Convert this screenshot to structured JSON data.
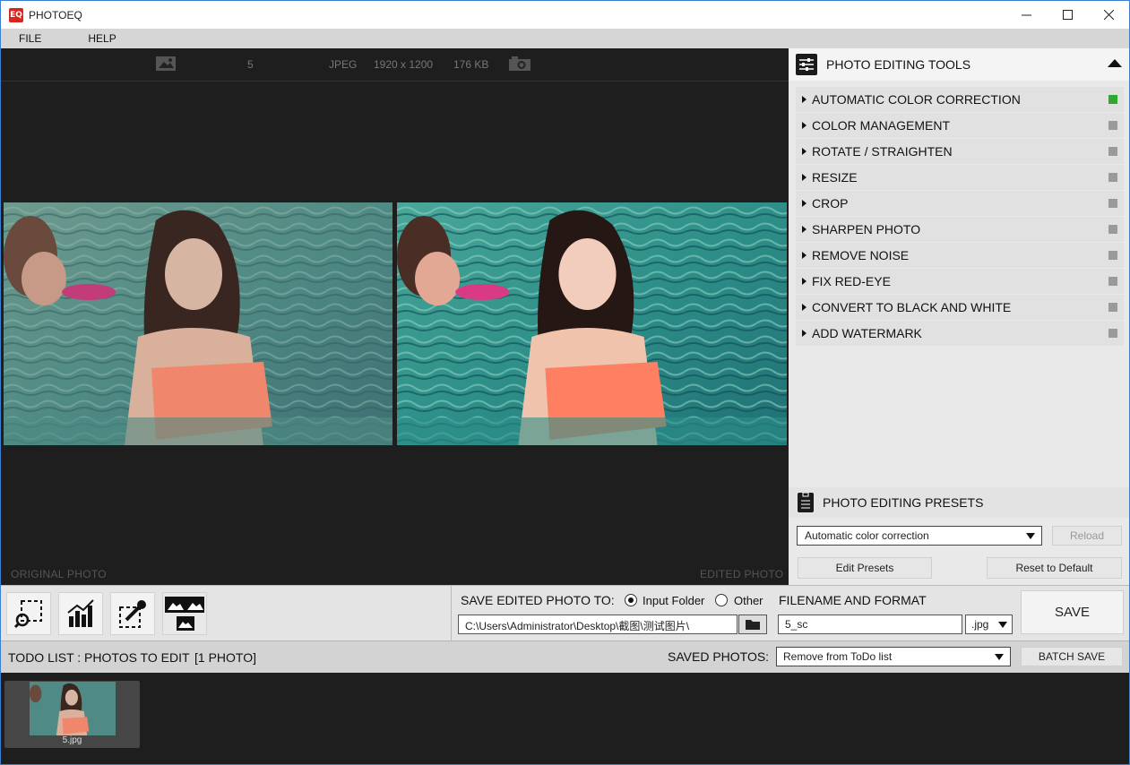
{
  "window": {
    "logo_text": "EQ",
    "title": "PHOTOEQ",
    "minimize_icon": "minimize-icon",
    "maximize_icon": "maximize-icon",
    "close_icon": "close-icon"
  },
  "menu": {
    "items": [
      {
        "label": "FILE"
      },
      {
        "label": "HELP"
      }
    ]
  },
  "viewer": {
    "info": {
      "photo_icon": "image-icon",
      "name": "5",
      "format": "JPEG",
      "dimensions": "1920 x 1200",
      "filesize": "176 KB",
      "camera_icon": "camera-icon"
    },
    "original_label": "ORIGINAL PHOTO",
    "edited_label": "EDITED PHOTO"
  },
  "tools": {
    "title": "PHOTO EDITING TOOLS",
    "items": [
      {
        "label": "AUTOMATIC COLOR CORRECTION",
        "enabled": true
      },
      {
        "label": "COLOR MANAGEMENT",
        "enabled": false
      },
      {
        "label": "ROTATE / STRAIGHTEN",
        "enabled": false
      },
      {
        "label": "RESIZE",
        "enabled": false
      },
      {
        "label": "CROP",
        "enabled": false
      },
      {
        "label": "SHARPEN PHOTO",
        "enabled": false
      },
      {
        "label": "REMOVE NOISE",
        "enabled": false
      },
      {
        "label": "FIX RED-EYE",
        "enabled": false
      },
      {
        "label": "CONVERT TO BLACK AND WHITE",
        "enabled": false
      },
      {
        "label": "ADD WATERMARK",
        "enabled": false
      }
    ],
    "enabled_color": "#2fa82f",
    "disabled_color": "#9a9a9a"
  },
  "presets": {
    "title": "PHOTO EDITING PRESETS",
    "selected": "Automatic color correction",
    "reload_label": "Reload",
    "edit_label": "Edit Presets",
    "reset_label": "Reset to Default"
  },
  "save": {
    "label": "SAVE EDITED PHOTO TO:",
    "input_folder_label": "Input Folder",
    "other_label": "Other",
    "selected_option": "Input Folder",
    "path": "C:\\Users\\Administrator\\Desktop\\截图\\测试图片\\",
    "filename_label": "FILENAME AND FORMAT",
    "filename": "5_sc",
    "format": ".jpg",
    "save_label": "SAVE"
  },
  "todo": {
    "title": "TODO LIST : PHOTOS TO EDIT",
    "count": "[1 PHOTO]",
    "saved_label": "SAVED PHOTOS:",
    "saved_option": "Remove from ToDo list",
    "batch_label": "BATCH SAVE",
    "items": [
      {
        "filename": "5.jpg"
      }
    ]
  }
}
